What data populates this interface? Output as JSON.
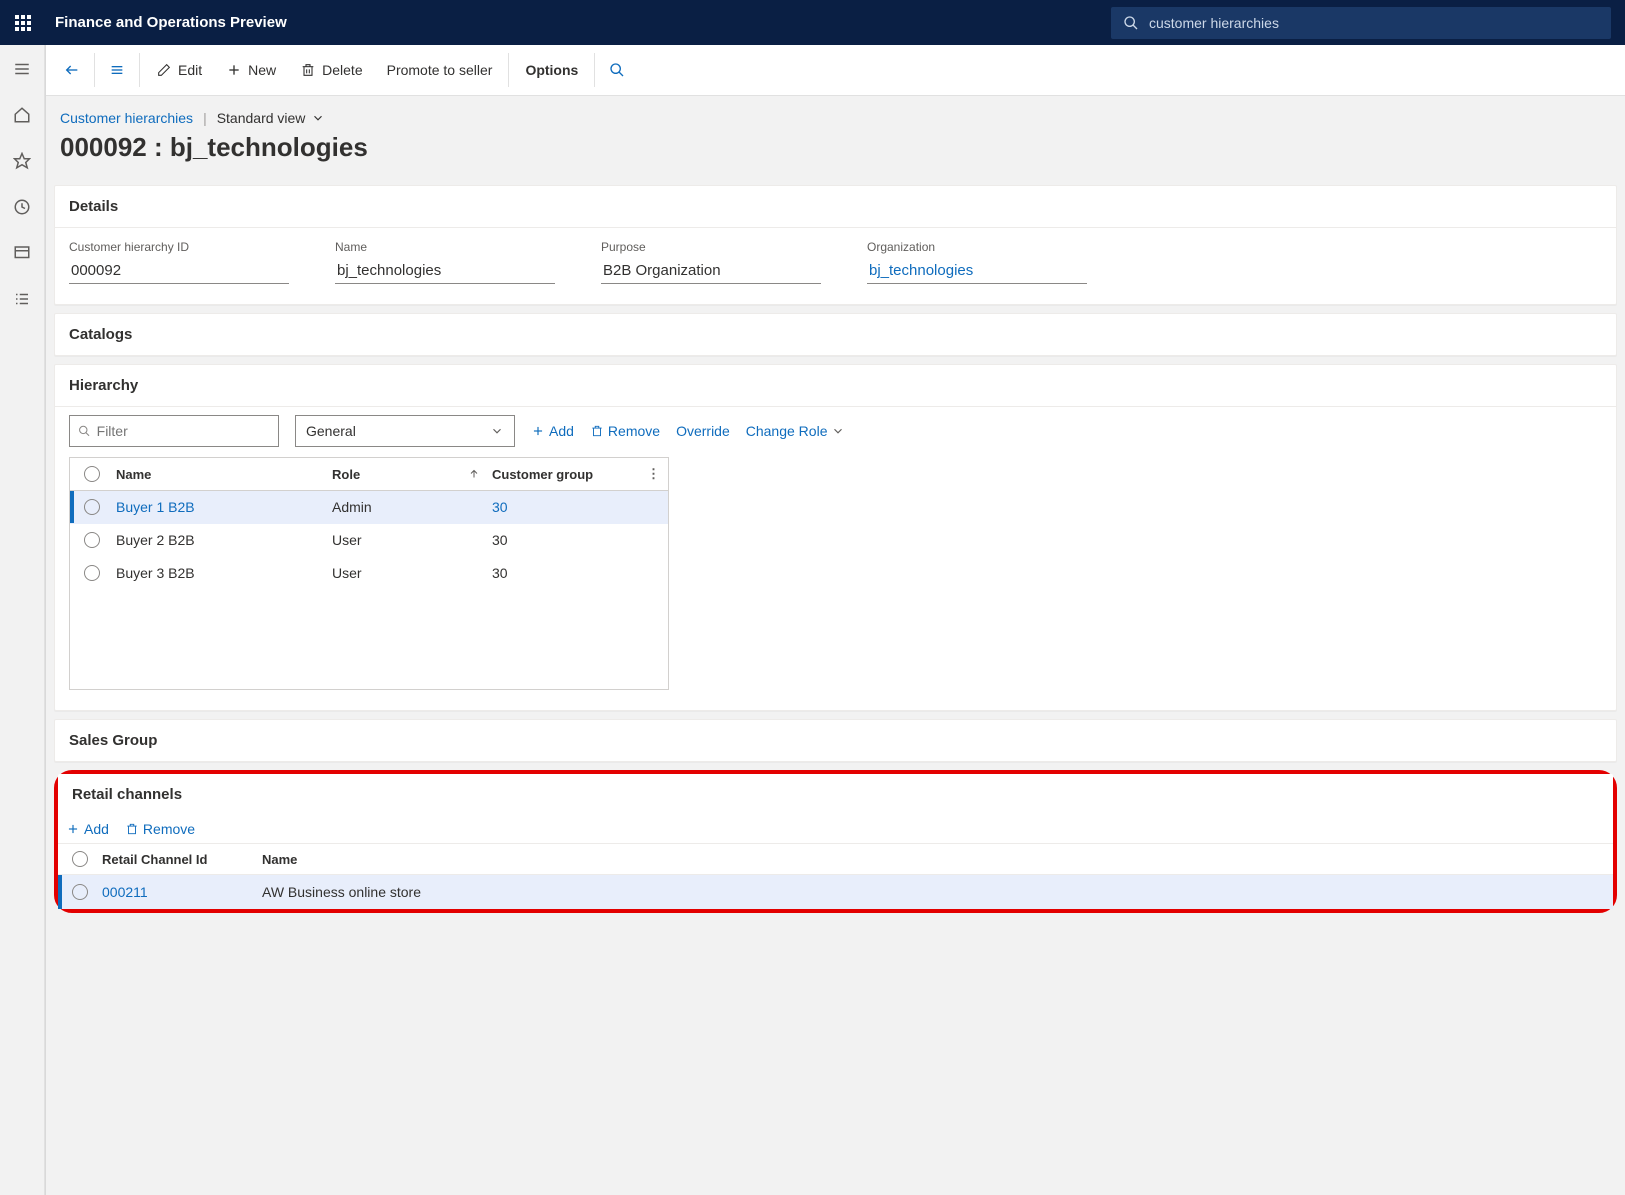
{
  "header": {
    "appTitle": "Finance and Operations Preview",
    "searchValue": "customer hierarchies"
  },
  "actions": {
    "edit": "Edit",
    "new": "New",
    "delete": "Delete",
    "promote": "Promote to seller",
    "options": "Options"
  },
  "breadcrumb": {
    "link": "Customer hierarchies",
    "view": "Standard view"
  },
  "page": {
    "title": "000092 : bj_technologies"
  },
  "details": {
    "header": "Details",
    "fields": {
      "idLabel": "Customer hierarchy ID",
      "idValue": "000092",
      "nameLabel": "Name",
      "nameValue": "bj_technologies",
      "purposeLabel": "Purpose",
      "purposeValue": "B2B Organization",
      "orgLabel": "Organization",
      "orgValue": "bj_technologies"
    }
  },
  "catalogs": {
    "header": "Catalogs"
  },
  "hierarchy": {
    "header": "Hierarchy",
    "filterPlaceholder": "Filter",
    "dropdownValue": "General",
    "tools": {
      "add": "Add",
      "remove": "Remove",
      "override": "Override",
      "changeRole": "Change Role"
    },
    "columns": {
      "name": "Name",
      "role": "Role",
      "group": "Customer group"
    },
    "rows": [
      {
        "name": "Buyer 1 B2B",
        "role": "Admin",
        "group": "30",
        "selected": true
      },
      {
        "name": "Buyer 2 B2B",
        "role": "User",
        "group": "30",
        "selected": false
      },
      {
        "name": "Buyer 3 B2B",
        "role": "User",
        "group": "30",
        "selected": false
      }
    ]
  },
  "salesGroup": {
    "header": "Sales Group"
  },
  "retail": {
    "header": "Retail channels",
    "tools": {
      "add": "Add",
      "remove": "Remove"
    },
    "columns": {
      "id": "Retail Channel Id",
      "name": "Name"
    },
    "rows": [
      {
        "id": "000211",
        "name": "AW Business online store",
        "selected": true
      }
    ]
  }
}
